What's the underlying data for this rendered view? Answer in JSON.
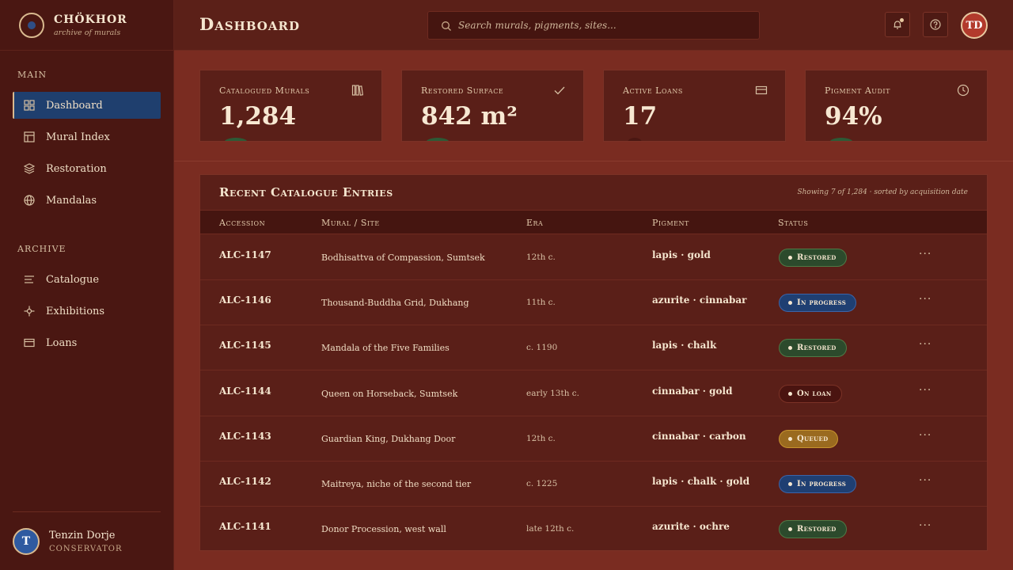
{
  "brand": {
    "name": "CHÖKHOR",
    "tagline": "archive of murals"
  },
  "sidebar": {
    "main_label": "MAIN",
    "archive_label": "ARCHIVE",
    "main_items": [
      {
        "label": "Dashboard",
        "icon": "grid-icon",
        "active": true
      },
      {
        "label": "Mural Index",
        "icon": "layout-icon"
      },
      {
        "label": "Restoration",
        "icon": "layers-icon"
      },
      {
        "label": "Mandalas",
        "icon": "globe-icon"
      }
    ],
    "archive_items": [
      {
        "label": "Catalogue",
        "icon": "list-icon"
      },
      {
        "label": "Exhibitions",
        "icon": "compass-icon"
      },
      {
        "label": "Loans",
        "icon": "card-icon"
      }
    ],
    "user": {
      "initial": "T",
      "name": "Tenzin Dorje",
      "role": "CONSERVATOR"
    }
  },
  "header": {
    "title": "Dashboard",
    "search_placeholder": "Search murals, pigments, sites...",
    "avatar_initials": "TD"
  },
  "stats": [
    {
      "label": "Catalogued Murals",
      "value": "1,284",
      "icon": "library-icon"
    },
    {
      "label": "Restored Surface",
      "value": "842 m²",
      "icon": "check-icon"
    },
    {
      "label": "Active Loans",
      "value": "17",
      "icon": "card-icon"
    },
    {
      "label": "Pigment Audit",
      "value": "94%",
      "icon": "clock-icon"
    }
  ],
  "table": {
    "title": "Recent Catalogue Entries",
    "meta": "Showing 7 of 1,284 · sorted by acquisition date",
    "columns": [
      "Accession",
      "Mural / Site",
      "Era",
      "Pigment",
      "Status"
    ],
    "rows": [
      {
        "accession": "ALC-1147",
        "mural": "Bodhisattva of Compassion, Sumtsek",
        "era": "12th c.",
        "pigment": "lapis · gold",
        "status": "Restored",
        "kind": "restored"
      },
      {
        "accession": "ALC-1146",
        "mural": "Thousand-Buddha Grid, Dukhang",
        "era": "11th c.",
        "pigment": "azurite · cinnabar",
        "status": "In progress",
        "kind": "progress"
      },
      {
        "accession": "ALC-1145",
        "mural": "Mandala of the Five Families",
        "era": "c. 1190",
        "pigment": "lapis · chalk",
        "status": "Restored",
        "kind": "restored"
      },
      {
        "accession": "ALC-1144",
        "mural": "Queen on Horseback, Sumtsek",
        "era": "early 13th c.",
        "pigment": "cinnabar · gold",
        "status": "On loan",
        "kind": "loan"
      },
      {
        "accession": "ALC-1143",
        "mural": "Guardian King, Dukhang Door",
        "era": "12th c.",
        "pigment": "cinnabar · carbon",
        "status": "Queued",
        "kind": "queued"
      },
      {
        "accession": "ALC-1142",
        "mural": "Maitreya, niche of the second tier",
        "era": "c. 1225",
        "pigment": "lapis · chalk · gold",
        "status": "In progress",
        "kind": "progress"
      },
      {
        "accession": "ALC-1141",
        "mural": "Donor Procession, west wall",
        "era": "late 12th c.",
        "pigment": "azurite · ochre",
        "status": "Restored",
        "kind": "restored"
      }
    ],
    "more_label": "···"
  }
}
